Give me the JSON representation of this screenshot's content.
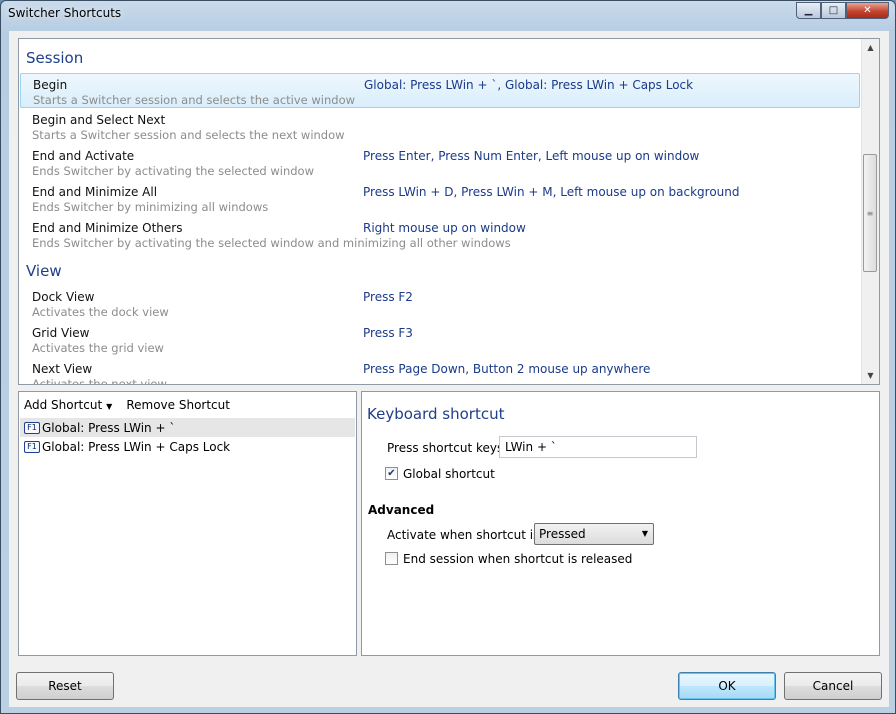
{
  "window": {
    "title": "Switcher Shortcuts"
  },
  "caption": {
    "minimize": "▁",
    "maximize": "□",
    "close": "✕"
  },
  "groups": [
    {
      "title": "Session",
      "items": [
        {
          "name": "Begin",
          "description": "Starts a Switcher session and selects the active window",
          "keys": "Global: Press LWin + `, Global: Press LWin + Caps Lock",
          "selected": true
        },
        {
          "name": "Begin and Select Next",
          "description": "Starts a Switcher session and selects the next window",
          "keys": ""
        },
        {
          "name": "End and Activate",
          "description": "Ends Switcher by activating the selected window",
          "keys": "Press Enter, Press Num Enter, Left mouse up on window"
        },
        {
          "name": "End and Minimize All",
          "description": "Ends Switcher by minimizing all windows",
          "keys": "Press LWin + D, Press LWin + M, Left mouse up on background"
        },
        {
          "name": "End and Minimize Others",
          "description": "Ends Switcher by activating the selected window and minimizing all other windows",
          "keys": "Right mouse up on window"
        }
      ]
    },
    {
      "title": "View",
      "items": [
        {
          "name": "Dock View",
          "description": "Activates the dock view",
          "keys": "Press F2"
        },
        {
          "name": "Grid View",
          "description": "Activates the grid view",
          "keys": "Press F3"
        },
        {
          "name": "Next View",
          "description": "Activates the next view",
          "keys": "Press Page Down, Button 2 mouse up anywhere"
        }
      ]
    }
  ],
  "shortcuts_panel": {
    "add_label": "Add Shortcut",
    "remove_label": "Remove Shortcut",
    "key_icon": "F1",
    "items": [
      "Global: Press LWin + `",
      "Global: Press LWin + Caps Lock"
    ]
  },
  "keyboard_panel": {
    "title": "Keyboard shortcut",
    "keys_label": "Press shortcut keys:",
    "keys_value": "LWin + `",
    "global_label": "Global shortcut",
    "global_checked": true,
    "advanced_label": "Advanced",
    "activate_label": "Activate when shortcut is:",
    "activate_value": "Pressed",
    "end_session_label": "End session when shortcut is released",
    "end_session_checked": false
  },
  "buttons": {
    "reset": "Reset",
    "ok": "OK",
    "cancel": "Cancel"
  }
}
